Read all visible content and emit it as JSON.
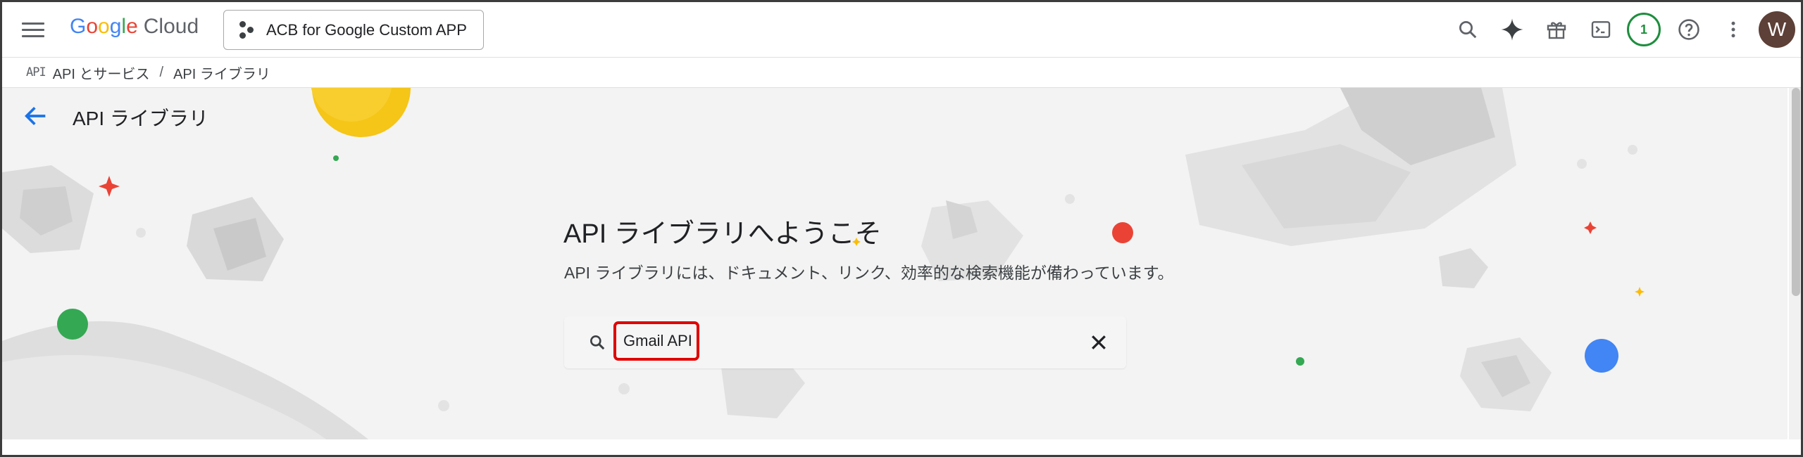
{
  "topbar": {
    "logo_letters": [
      "G",
      "o",
      "o",
      "g",
      "l",
      "e"
    ],
    "logo_suffix": "Cloud",
    "project_name": "ACB for Google Custom APP",
    "notification_count": "1",
    "avatar_initial": "W"
  },
  "breadcrumb": {
    "icon_text": "API",
    "items": [
      "API とサービス",
      "API ライブラリ"
    ],
    "separator": "/"
  },
  "page": {
    "title": "API ライブラリ",
    "welcome_heading": "API ライブラリへようこそ",
    "description": "API ライブラリには、ドキュメント、リンク、効率的な検索機能が備わっています。"
  },
  "search": {
    "value": "Gmail API"
  },
  "icons": {
    "menu": "hamburger-menu-icon",
    "search": "search-icon",
    "gemini": "sparkle-icon",
    "gift": "gift-icon",
    "terminal": "cloud-shell-icon",
    "help": "help-icon",
    "more": "more-vert-icon",
    "back": "arrow-back-icon",
    "clear": "close-icon"
  },
  "colors": {
    "google_blue": "#4285F4",
    "google_red": "#EA4335",
    "google_yellow": "#FBBC05",
    "google_green": "#34A853",
    "highlight_border": "#E00000",
    "avatar_bg": "#5D4037"
  }
}
